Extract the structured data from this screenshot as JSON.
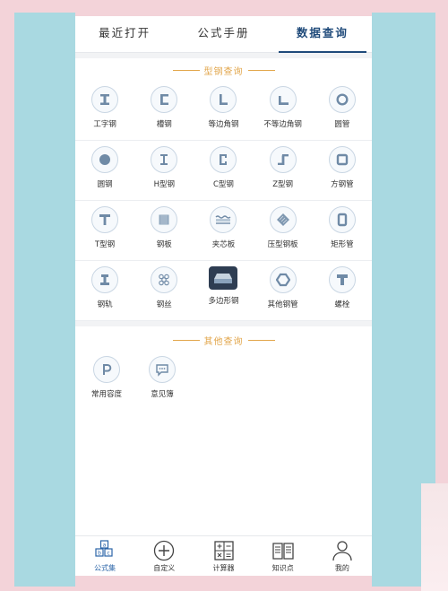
{
  "tabs": [
    {
      "label": "最近打开"
    },
    {
      "label": "公式手册"
    },
    {
      "label": "数据查询"
    }
  ],
  "steel_section": {
    "title": "型钢查询",
    "rows": [
      [
        {
          "label": "工字钢",
          "icon": "i-beam-icon"
        },
        {
          "label": "槽钢",
          "icon": "channel-steel-icon"
        },
        {
          "label": "等边角钢",
          "icon": "equal-angle-icon"
        },
        {
          "label": "不等边角钢",
          "icon": "unequal-angle-icon"
        },
        {
          "label": "圆管",
          "icon": "round-pipe-icon"
        }
      ],
      [
        {
          "label": "圆钢",
          "icon": "round-bar-icon"
        },
        {
          "label": "H型钢",
          "icon": "h-beam-icon"
        },
        {
          "label": "C型钢",
          "icon": "c-section-icon"
        },
        {
          "label": "Z型钢",
          "icon": "z-section-icon"
        },
        {
          "label": "方钢管",
          "icon": "square-tube-icon"
        }
      ],
      [
        {
          "label": "T型钢",
          "icon": "t-section-icon"
        },
        {
          "label": "钢板",
          "icon": "steel-plate-icon"
        },
        {
          "label": "夹芯板",
          "icon": "sandwich-panel-icon"
        },
        {
          "label": "压型钢板",
          "icon": "profiled-sheet-icon"
        },
        {
          "label": "矩形管",
          "icon": "rect-tube-icon"
        }
      ],
      [
        {
          "label": "钢轨",
          "icon": "rail-icon"
        },
        {
          "label": "钢丝",
          "icon": "steel-wire-icon"
        },
        {
          "label": "多边形钢",
          "icon": "polygon-steel-icon"
        },
        {
          "label": "其他钢管",
          "icon": "other-pipe-icon"
        },
        {
          "label": "螺栓",
          "icon": "bolt-icon"
        }
      ]
    ]
  },
  "other_section": {
    "title": "其他查询",
    "items": [
      {
        "label": "常用容度",
        "icon": "density-icon"
      },
      {
        "label": "意见簿",
        "icon": "feedback-icon"
      }
    ]
  },
  "bottom_nav": [
    {
      "label": "公式集",
      "icon": "formula-icon"
    },
    {
      "label": "自定义",
      "icon": "add-icon"
    },
    {
      "label": "计算器",
      "icon": "calculator-icon"
    },
    {
      "label": "知识点",
      "icon": "book-icon"
    },
    {
      "label": "我的",
      "icon": "user-icon"
    }
  ],
  "colors": {
    "accent": "#1f4a7a",
    "section_title": "#e2a64b",
    "icon_stroke": "#6f8aa6",
    "background_blue": "#a9d9e1",
    "background_pink": "#f3d3d9"
  }
}
